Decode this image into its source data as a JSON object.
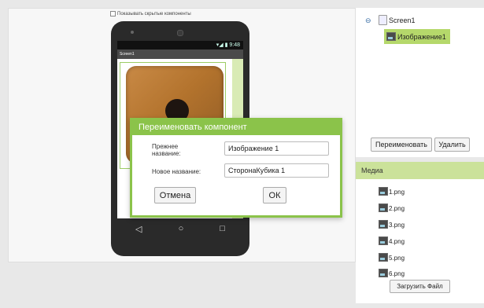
{
  "designer": {
    "show_hidden_label": "Показывать скрытые компоненты",
    "status_time": "9:48",
    "screen_title": "Screen1",
    "nav": [
      "◁",
      "○",
      "□"
    ]
  },
  "components": {
    "root_label": "Screen1",
    "item_label": "Изображение1",
    "rename_button": "Переименовать",
    "delete_button": "Удалить"
  },
  "media": {
    "header": "Медиа",
    "files": [
      "1.png",
      "2.png",
      "3.png",
      "4.png",
      "5.png",
      "6.png"
    ],
    "upload_button": "Загрузить Файл"
  },
  "dialog": {
    "title": "Переименовать компонент",
    "old_name_label": "Прежнее название:",
    "old_name_value": "Изображение 1",
    "new_name_label": "Новое название:",
    "new_name_value": "СторонаКубика 1",
    "cancel_button": "Отмена",
    "ok_button": "ОК"
  },
  "colors": {
    "accent": "#8bc34a",
    "selection": "#b5d86b",
    "media_header": "#cbe29a"
  }
}
